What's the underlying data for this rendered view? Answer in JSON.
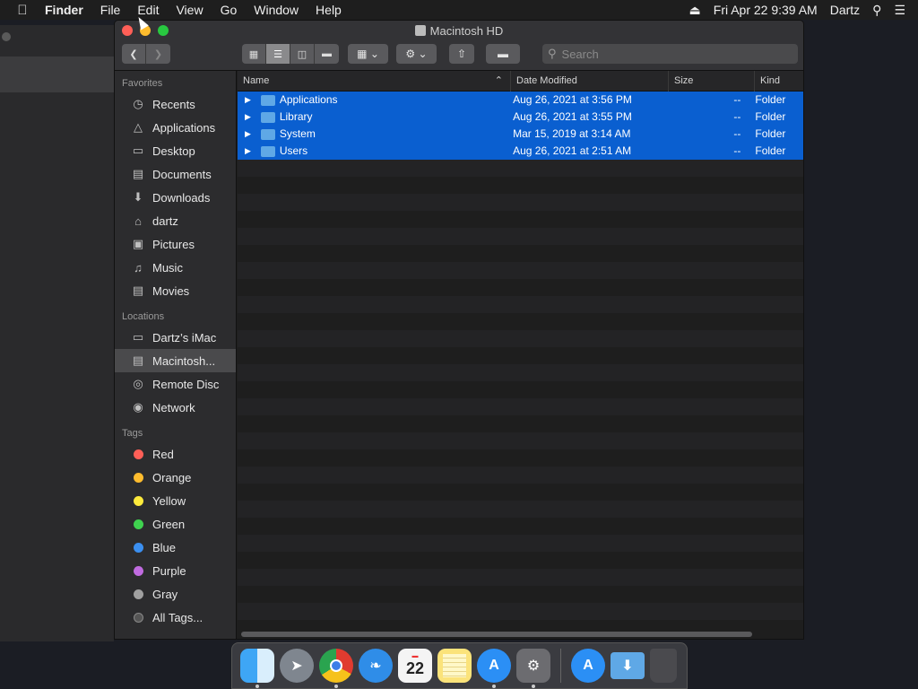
{
  "menubar": {
    "items": [
      "Finder",
      "File",
      "Edit",
      "View",
      "Go",
      "Window",
      "Help"
    ],
    "datetime": "Fri Apr 22  9:39 AM",
    "user": "Dartz"
  },
  "window": {
    "title": "Macintosh HD",
    "search_placeholder": "Search"
  },
  "sidebar": {
    "favorites_header": "Favorites",
    "favorites": [
      {
        "label": "Recents",
        "icon": "clock-icon"
      },
      {
        "label": "Applications",
        "icon": "applications-icon"
      },
      {
        "label": "Desktop",
        "icon": "desktop-icon"
      },
      {
        "label": "Documents",
        "icon": "documents-icon"
      },
      {
        "label": "Downloads",
        "icon": "downloads-icon"
      },
      {
        "label": "dartz",
        "icon": "home-icon"
      },
      {
        "label": "Pictures",
        "icon": "camera-icon"
      },
      {
        "label": "Music",
        "icon": "music-icon"
      },
      {
        "label": "Movies",
        "icon": "film-icon"
      }
    ],
    "locations_header": "Locations",
    "locations": [
      {
        "label": "Dartz’s iMac",
        "icon": "imac-icon"
      },
      {
        "label": "Macintosh...",
        "icon": "harddisk-icon"
      },
      {
        "label": "Remote Disc",
        "icon": "disc-icon"
      },
      {
        "label": "Network",
        "icon": "network-icon"
      }
    ],
    "tags_header": "Tags",
    "tags": [
      {
        "label": "Red",
        "color": "#ff5f57"
      },
      {
        "label": "Orange",
        "color": "#febc2e"
      },
      {
        "label": "Yellow",
        "color": "#fdea3c"
      },
      {
        "label": "Green",
        "color": "#3fd24f"
      },
      {
        "label": "Blue",
        "color": "#3b8ff0"
      },
      {
        "label": "Purple",
        "color": "#c06be0"
      },
      {
        "label": "Gray",
        "color": "#a0a0a0"
      },
      {
        "label": "All Tags...",
        "color": "#555555"
      }
    ]
  },
  "table": {
    "columns": [
      "Name",
      "Date Modified",
      "Size",
      "Kind"
    ],
    "rows": [
      {
        "name": "Applications",
        "date": "Aug 26, 2021 at 3:56 PM",
        "size": "--",
        "kind": "Folder"
      },
      {
        "name": "Library",
        "date": "Aug 26, 2021 at 3:55 PM",
        "size": "--",
        "kind": "Folder"
      },
      {
        "name": "System",
        "date": "Mar 15, 2019 at 3:14 AM",
        "size": "--",
        "kind": "Folder"
      },
      {
        "name": "Users",
        "date": "Aug 26, 2021 at 2:51 AM",
        "size": "--",
        "kind": "Folder"
      }
    ]
  },
  "dock": {
    "calendar_day": "22",
    "apps": [
      "finder-icon",
      "launchpad-icon",
      "chrome-icon",
      "safari-icon",
      "calendar-icon",
      "notes-icon",
      "app-store-icon",
      "system-preferences-icon",
      "app-store-downloads-icon",
      "folder-icon",
      "trash-icon"
    ]
  }
}
